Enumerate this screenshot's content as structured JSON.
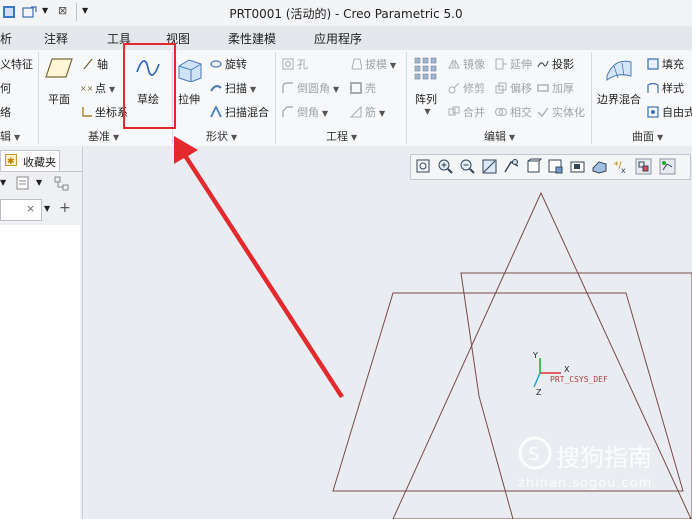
{
  "window": {
    "title": "PRT0001 (活动的) - Creo Parametric 5.0"
  },
  "tabs": [
    "析",
    "注释",
    "工具",
    "视图",
    "柔性建模",
    "应用程序"
  ],
  "ribbon": {
    "left_partial": [
      "义特征",
      "何",
      "络"
    ],
    "datum": {
      "plane": "平面",
      "axis": "轴",
      "point": "点",
      "csys": "坐标系",
      "sketch": "草绘",
      "group": "基准"
    },
    "shapes": {
      "extrude": "拉伸",
      "revolve": "旋转",
      "sweep": "扫描",
      "swept_blend": "扫描混合",
      "group": "形状"
    },
    "engineering": {
      "hole": "孔",
      "round": "倒圆角",
      "chamfer": "倒角",
      "draft": "拔模",
      "shell": "壳",
      "rib": "筋",
      "group": "工程"
    },
    "editing": {
      "pattern": "阵列",
      "mirror": "镜像",
      "trim": "修剪",
      "merge": "合并",
      "extend": "延伸",
      "offset": "偏移",
      "intersect": "相交",
      "project": "投影",
      "thicken": "加厚",
      "solidify": "实体化",
      "group": "编辑"
    },
    "surfaces": {
      "boundary_blend": "边界混合",
      "fill": "填充",
      "style": "样式",
      "freeform": "自由式",
      "group": "曲面"
    },
    "left_group_partial": "辑"
  },
  "left_panel": {
    "tab_label": "收藏夹"
  },
  "viewport": {
    "csys_label": "PRT_CSYS_DEF",
    "axis_x": "X",
    "axis_y": "Y",
    "axis_z": "Z"
  },
  "watermark": {
    "brand": "搜狗指南",
    "url": "zhinan.sogou.com"
  },
  "colors": {
    "highlight": "#e3292e",
    "datum_edge": "#7a4a4a",
    "csys_x": "#e03030",
    "csys_y": "#22aa22",
    "csys_z": "#22aacc"
  }
}
